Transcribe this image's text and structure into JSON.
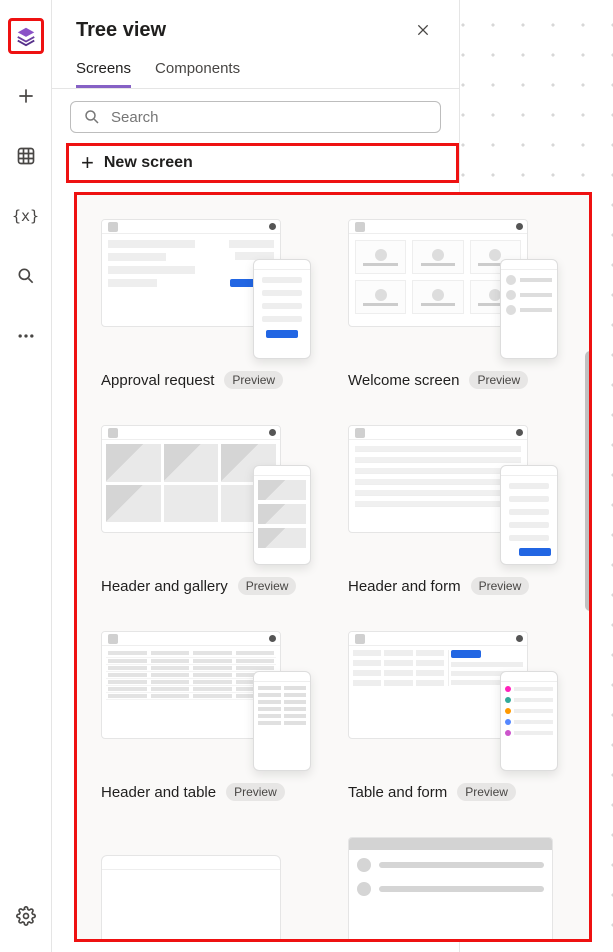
{
  "panel": {
    "title": "Tree view",
    "tabs": [
      "Screens",
      "Components"
    ],
    "activeTabIndex": 0,
    "searchPlaceholder": "Search",
    "newScreenLabel": "New screen"
  },
  "badges": {
    "preview": "Preview"
  },
  "templates": [
    {
      "label": "Approval request",
      "badge": "preview"
    },
    {
      "label": "Welcome screen",
      "badge": "preview"
    },
    {
      "label": "Header and gallery",
      "badge": "preview"
    },
    {
      "label": "Header and form",
      "badge": "preview"
    },
    {
      "label": "Header and table",
      "badge": "preview"
    },
    {
      "label": "Table and form",
      "badge": "preview"
    }
  ],
  "railIcons": [
    "layers",
    "plus",
    "grid",
    "variable",
    "search",
    "more"
  ],
  "railBottomIcon": "settings"
}
